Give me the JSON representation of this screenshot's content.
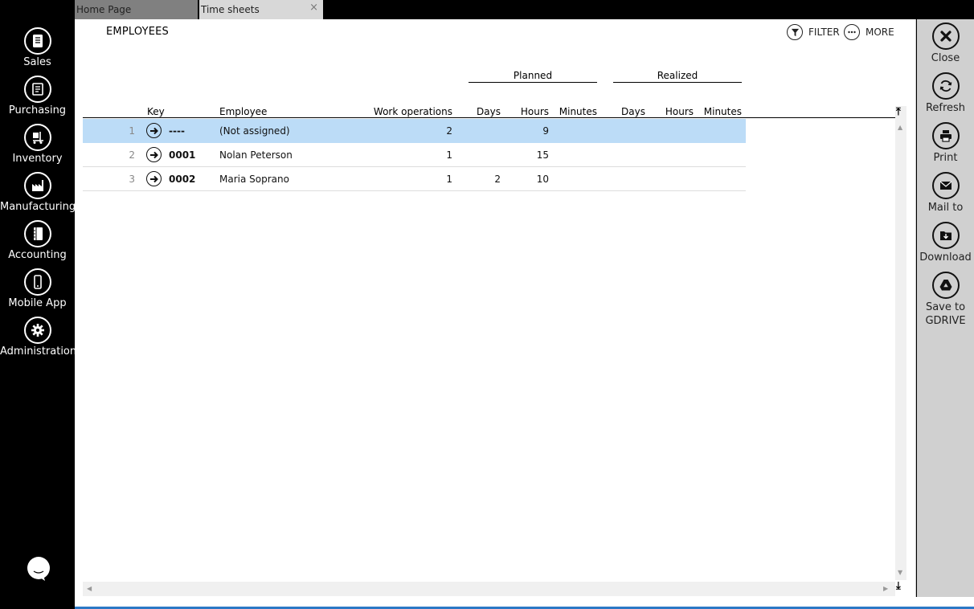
{
  "tabs": [
    {
      "label": "Home Page"
    },
    {
      "label": "Time sheets",
      "close": "×"
    }
  ],
  "nav": [
    {
      "label": "Sales",
      "icon": "sales-icon"
    },
    {
      "label": "Purchasing",
      "icon": "purchasing-icon"
    },
    {
      "label": "Inventory",
      "icon": "inventory-icon"
    },
    {
      "label": "Manufacturing",
      "icon": "manufacturing-icon"
    },
    {
      "label": "Accounting",
      "icon": "accounting-icon"
    },
    {
      "label": "Mobile App",
      "icon": "mobile-icon"
    },
    {
      "label": "Administration",
      "icon": "gear-icon"
    }
  ],
  "page": {
    "title": "EMPLOYEES",
    "filter_label": "FILTER",
    "more_label": "MORE"
  },
  "table": {
    "groups": {
      "planned": "Planned",
      "realized": "Realized"
    },
    "columns": {
      "key": "Key",
      "employee": "Employee",
      "work_operations": "Work operations",
      "planned_days": "Days",
      "planned_hours": "Hours",
      "planned_minutes": "Minutes",
      "realized_days": "Days",
      "realized_hours": "Hours",
      "realized_minutes": "Minutes"
    },
    "rows": [
      {
        "num": "1",
        "key": "----",
        "employee": "(Not assigned)",
        "work_operations": "2",
        "planned_days": "",
        "planned_hours": "9",
        "selected": true
      },
      {
        "num": "2",
        "key": "0001",
        "employee": "Nolan Peterson",
        "work_operations": "1",
        "planned_days": "",
        "planned_hours": "15",
        "selected": false
      },
      {
        "num": "3",
        "key": "0002",
        "employee": "Maria Soprano",
        "work_operations": "1",
        "planned_days": "2",
        "planned_hours": "10",
        "selected": false
      }
    ]
  },
  "actions": [
    {
      "label": "Close",
      "icon": "close-icon"
    },
    {
      "label": "Refresh",
      "icon": "refresh-icon"
    },
    {
      "label": "Print",
      "icon": "print-icon"
    },
    {
      "label": "Mail to",
      "icon": "mail-icon"
    },
    {
      "label": "Download",
      "icon": "download-icon"
    },
    {
      "label": "Save to GDRIVE",
      "icon": "gdrive-icon"
    }
  ],
  "colors": {
    "selected_row": "#bcdcf7",
    "active_tab": "#d8d8d8",
    "inactive_tab": "#808080",
    "right_bar": "#d0d0d0"
  }
}
